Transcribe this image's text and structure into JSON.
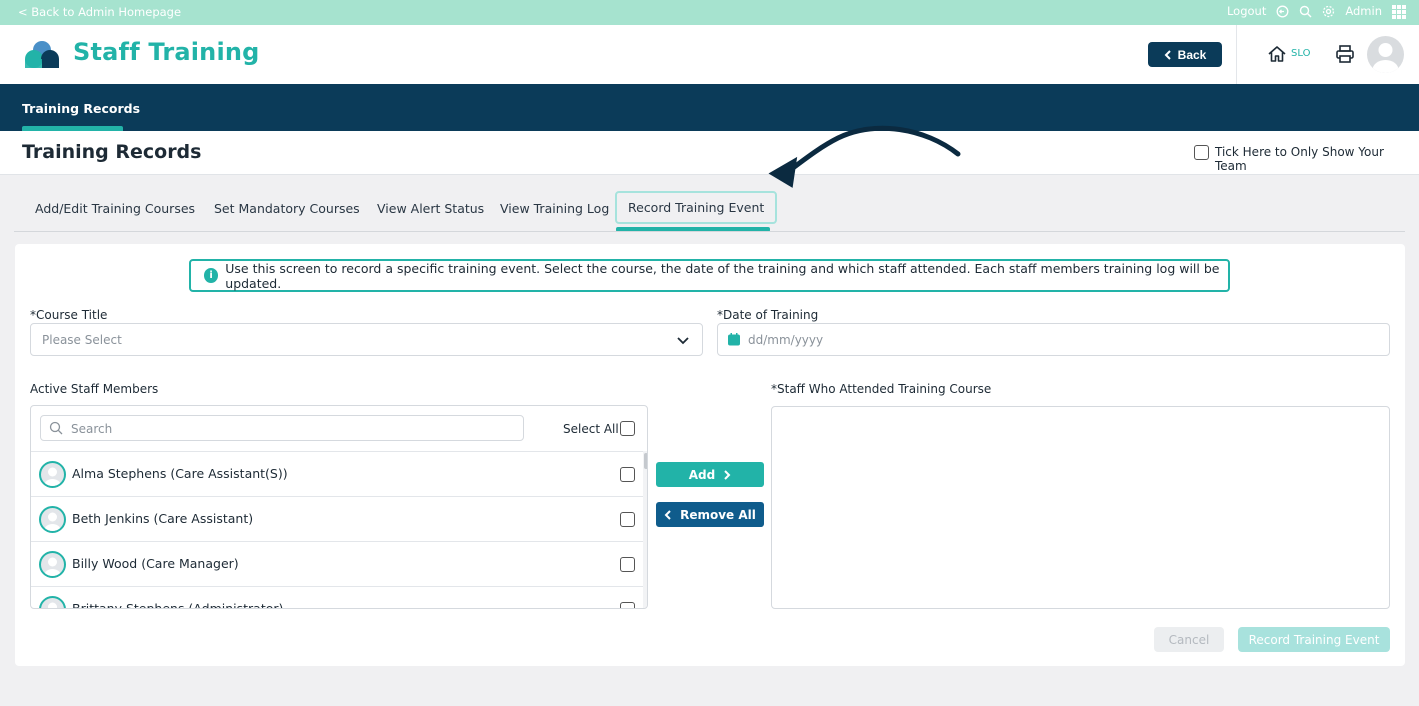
{
  "topbar": {
    "back_link": "< Back to Admin Homepage",
    "logout": "Logout",
    "admin": "Admin"
  },
  "header": {
    "app_title": "Staff Training",
    "back_button": "Back",
    "home_code": "SLO"
  },
  "nav": {
    "active_tab": "Training Records"
  },
  "page": {
    "title": "Training Records",
    "team_filter_label": "Tick Here to Only Show Your Team"
  },
  "subtabs": [
    {
      "label": "Add/Edit Training Courses"
    },
    {
      "label": "Set Mandatory Courses"
    },
    {
      "label": "View Alert Status"
    },
    {
      "label": "View Training Log"
    },
    {
      "label": "Record Training Event",
      "active": true
    }
  ],
  "info_text": "Use this screen to record a specific training event. Select the course, the date of the training and which staff attended. Each staff members training log will be updated.",
  "form": {
    "course_label": "*Course Title",
    "course_placeholder": "Please Select",
    "date_label": "*Date of Training",
    "date_placeholder": "dd/mm/yyyy",
    "active_staff_label": "Active Staff Members",
    "search_placeholder": "Search",
    "select_all_label": "Select All",
    "attended_label": "*Staff Who Attended Training Course"
  },
  "staff": [
    {
      "name": "Alma Stephens (Care Assistant(S))"
    },
    {
      "name": "Beth Jenkins (Care Assistant)"
    },
    {
      "name": "Billy Wood (Care Manager)"
    },
    {
      "name": "Brittany Stephens (Administrator)"
    }
  ],
  "buttons": {
    "add": "Add",
    "remove_all": "Remove All",
    "cancel": "Cancel",
    "record": "Record Training Event"
  },
  "colors": {
    "teal": "#22b3a8",
    "navy": "#0b3b59",
    "top_strip": "#a6e3cf"
  }
}
